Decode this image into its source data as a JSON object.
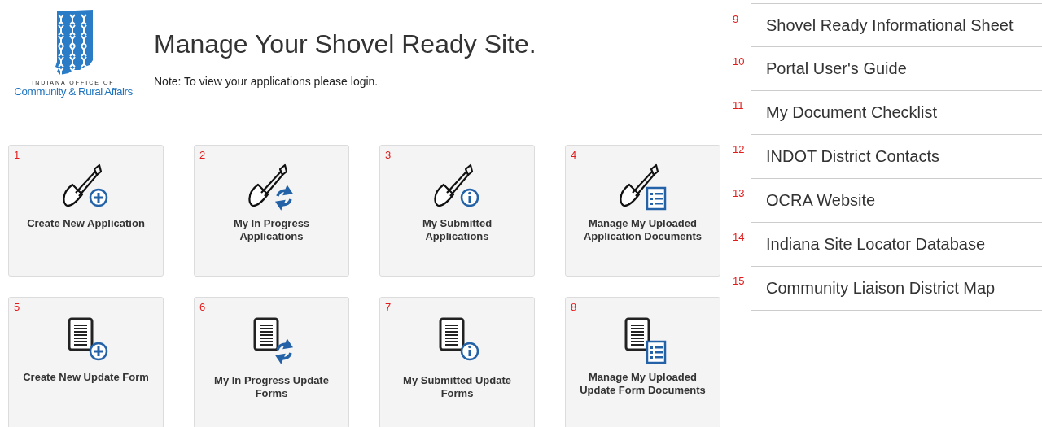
{
  "logo": {
    "line_1": "INDIANA OFFICE OF",
    "line_2": "Community & Rural Affairs"
  },
  "title": "Manage Your Shovel Ready Site.",
  "note": "Note: To view your applications please login.",
  "tile_rows": [
    {
      "kind": "shovel",
      "tiles": [
        {
          "number": "1",
          "label": "Create New Application",
          "kind": "plus"
        },
        {
          "number": "2",
          "label": "My In Progress Applications",
          "kind": "refresh"
        },
        {
          "number": "3",
          "label": "My Submitted Applications",
          "kind": "info"
        },
        {
          "number": "4",
          "label": "Manage My Uploaded Application Documents",
          "kind": "list"
        }
      ]
    },
    {
      "kind": "document",
      "tiles": [
        {
          "number": "5",
          "label": "Create New Update Form",
          "kind": "plus"
        },
        {
          "number": "6",
          "label": "My In Progress Update Forms",
          "kind": "refresh"
        },
        {
          "number": "7",
          "label": "My Submitted Update Forms",
          "kind": "info"
        },
        {
          "number": "8",
          "label": "Manage My Uploaded Update Form Documents",
          "kind": "list"
        }
      ]
    }
  ],
  "links": [
    {
      "number": "9",
      "label": "Shovel Ready Informational Sheet"
    },
    {
      "number": "10",
      "label": "Portal User's Guide"
    },
    {
      "number": "11",
      "label": "My Document Checklist"
    },
    {
      "number": "12",
      "label": "INDOT District Contacts"
    },
    {
      "number": "13",
      "label": "OCRA Website"
    },
    {
      "number": "14",
      "label": "Indiana Site Locator Database"
    },
    {
      "number": "15",
      "label": "Community Liaison District Map"
    }
  ]
}
